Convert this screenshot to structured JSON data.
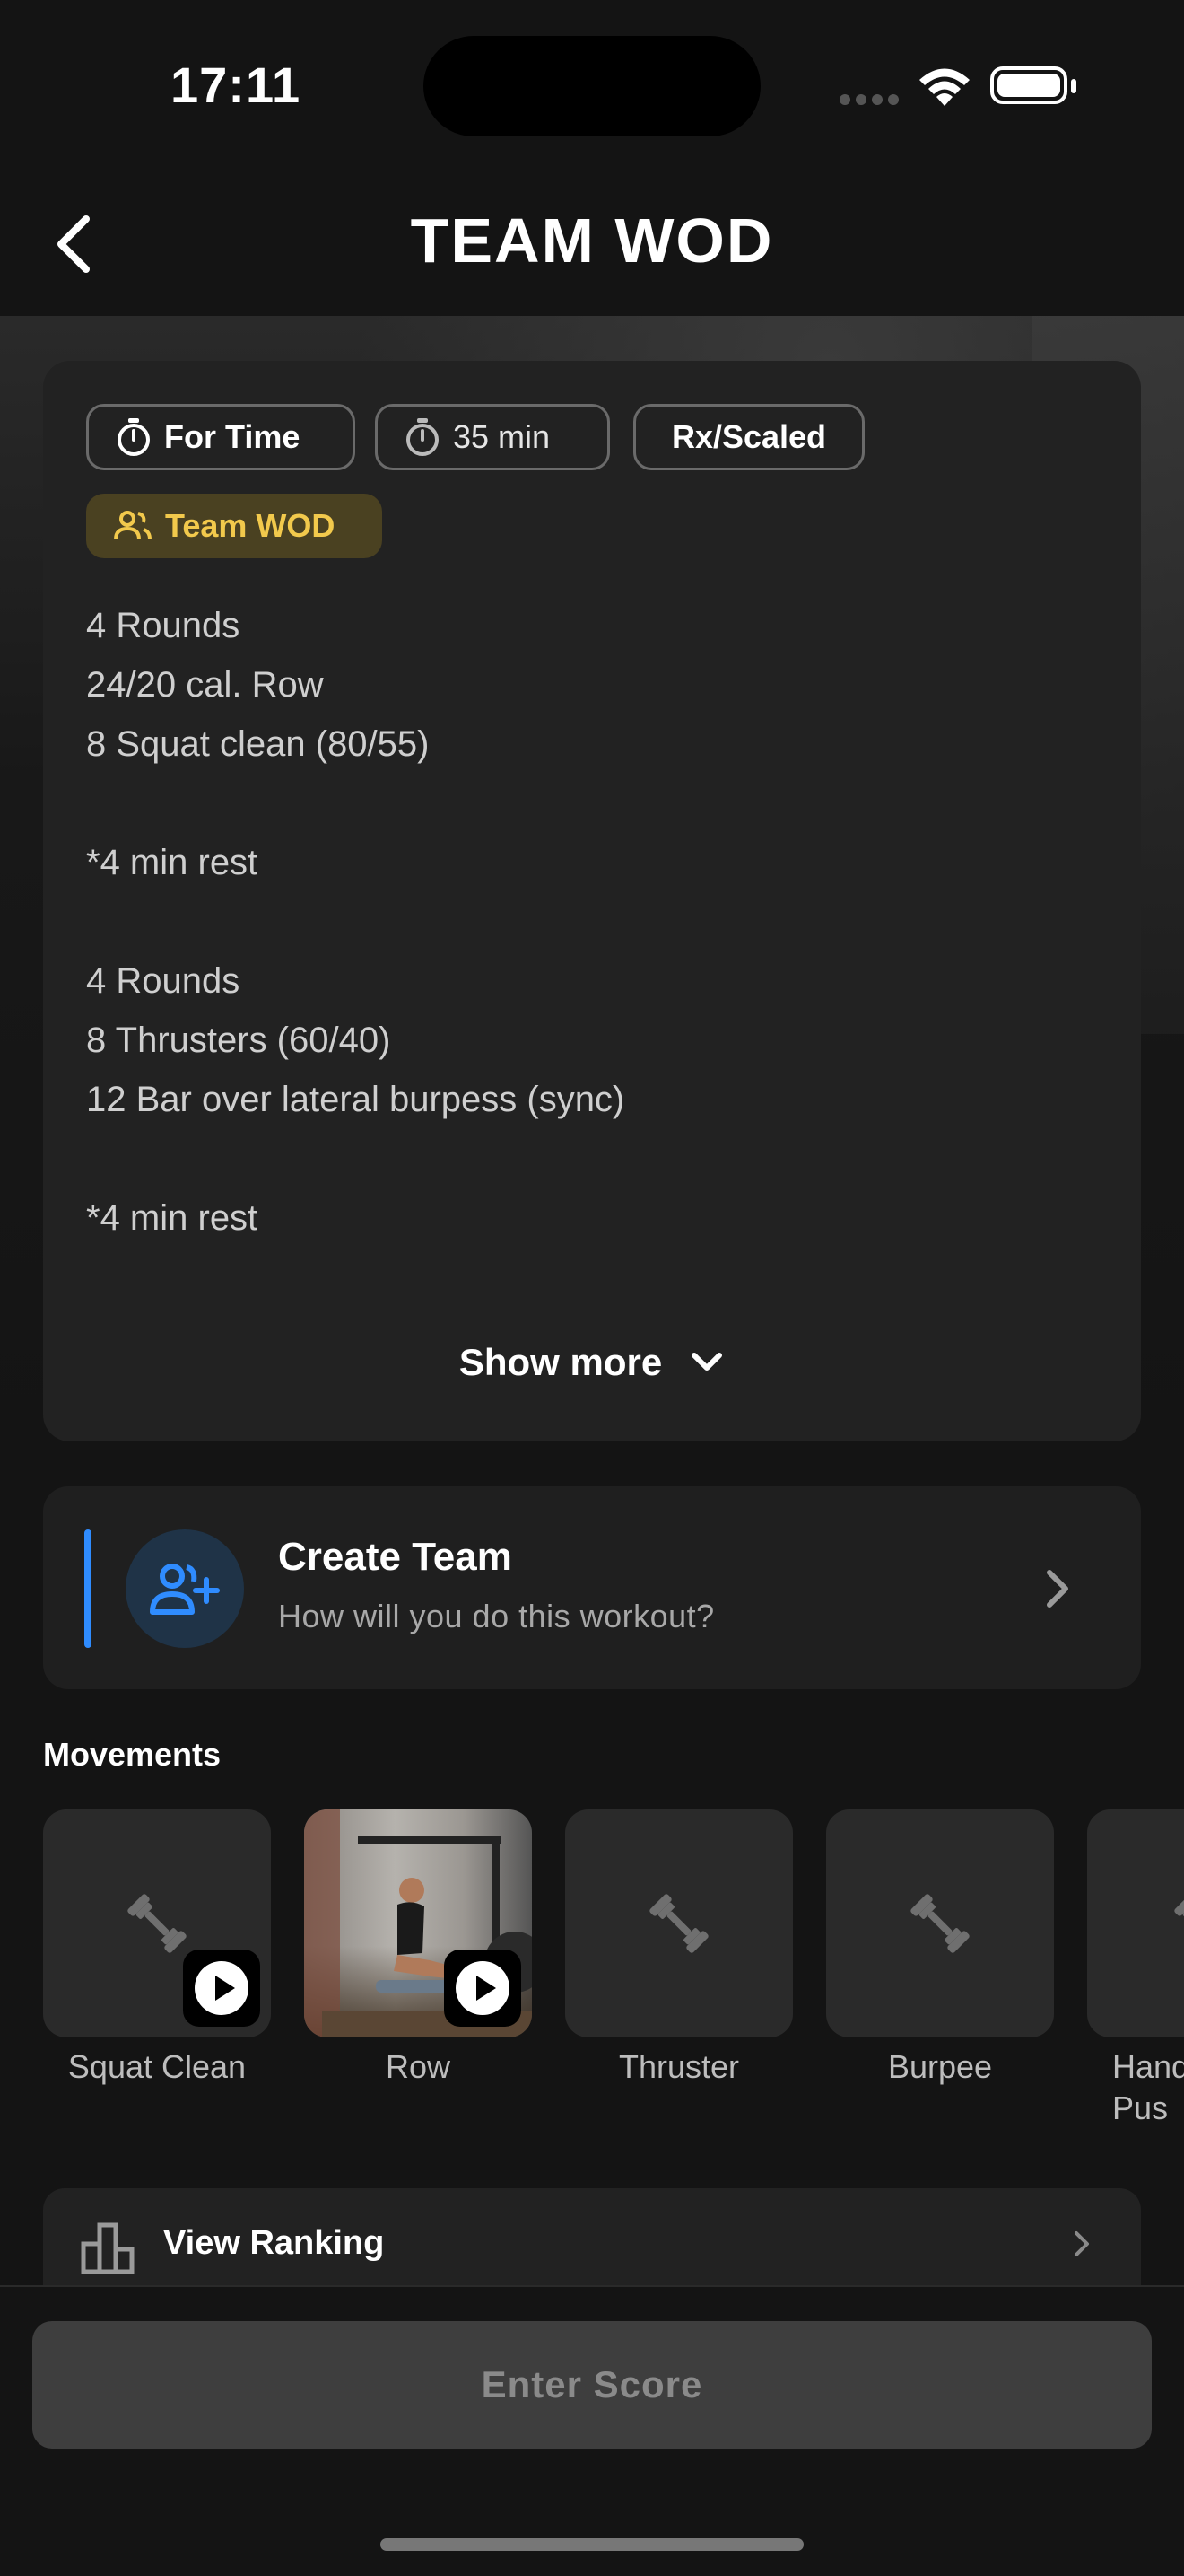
{
  "status_bar": {
    "time": "17:11"
  },
  "header": {
    "title": "TEAM WOD"
  },
  "wod": {
    "chips": {
      "type": "For Time",
      "duration": "35 min",
      "level": "Rx/Scaled",
      "category": "Team WOD"
    },
    "description": "4 Rounds\n24/20 cal. Row\n8 Squat clean (80/55)\n\n*4 min rest\n\n4 Rounds\n8 Thrusters (60/40)\n12 Bar over lateral burpess (sync)\n\n*4 min rest",
    "show_more": "Show more"
  },
  "team": {
    "title": "Create Team",
    "subtitle": "How will you do this workout?"
  },
  "movements": {
    "heading": "Movements",
    "items": [
      {
        "label": "Squat Clean",
        "has_video": true,
        "has_photo": false
      },
      {
        "label": "Row",
        "has_video": true,
        "has_photo": true
      },
      {
        "label": "Thruster",
        "has_video": false,
        "has_photo": false
      },
      {
        "label": "Burpee",
        "has_video": false,
        "has_photo": false
      },
      {
        "label": "Hand\nPus",
        "has_video": false,
        "has_photo": false
      }
    ]
  },
  "ranking": {
    "label": "View Ranking"
  },
  "actions": {
    "enter_score": "Enter Score"
  },
  "colors": {
    "accent_blue": "#2f8cff",
    "team_chip_text": "#f2c94c",
    "team_chip_bg": "#4a4121"
  }
}
